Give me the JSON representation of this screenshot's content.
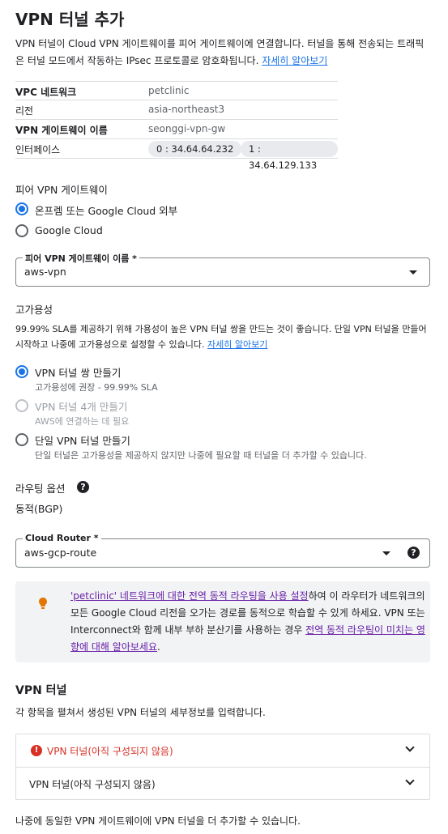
{
  "page": {
    "title": "VPN 터널 추가",
    "intro_text": "VPN 터널이 Cloud VPN 게이트웨이를 피어 게이트웨이에 연결합니다. 터널을 통해 전송되는 트래픽은 터널 모드에서 작동하는 IPsec 프로토콜로 암호화됩니다.",
    "intro_link": "자세히 알아보기"
  },
  "info_table": {
    "rows": [
      {
        "key": "VPC 네트워크",
        "value": "petclinic"
      },
      {
        "key": "리전",
        "value": "asia-northeast3"
      },
      {
        "key": "VPN 게이트웨이 이름",
        "value": "seonggi-vpn-gw"
      },
      {
        "key": "인터페이스",
        "value": ""
      }
    ],
    "interfaces": [
      "0 : 34.64.64.232",
      "1 : 34.64.129.133"
    ]
  },
  "peer_gateway": {
    "label": "피어 VPN 게이트웨이",
    "options": [
      {
        "label": "온프렘 또는 Google Cloud 외부",
        "selected": true
      },
      {
        "label": "Google Cloud",
        "selected": false
      }
    ],
    "name_field_label": "피어 VPN 게이트웨이 이름 *",
    "name_field_value": "aws-vpn"
  },
  "high_availability": {
    "label": "고가용성",
    "description": "99.99% SLA를 제공하기 위해 가용성이 높은 VPN 터널 쌍을 만드는 것이 좋습니다. 단일 VPN 터널을 만들어 시작하고 나중에 고가용성으로 설정할 수 있습니다.",
    "link": "자세히 알아보기",
    "options": [
      {
        "label": "VPN 터널 쌍 만들기",
        "sub": "고가용성에 권장 - 99.99% SLA",
        "selected": true,
        "disabled": false
      },
      {
        "label": "VPN 터널 4개 만들기",
        "sub": "AWS에 연결하는 데 필요",
        "selected": false,
        "disabled": true
      },
      {
        "label": "단일 VPN 터널 만들기",
        "sub": "단일 터널은 고가용성을 제공하지 않지만 나중에 필요할 때 터널을 더 추가할 수 있습니다.",
        "selected": false,
        "disabled": false
      }
    ]
  },
  "routing": {
    "label": "라우팅 옵션",
    "value": "동적(BGP)",
    "router_field_label": "Cloud Router *",
    "router_field_value": "aws-gcp-route"
  },
  "callout": {
    "link1": "'petclinic' 네트워크에 대한 전역 동적 라우팅을 사용 설정",
    "text1": "하여 이 라우터가 네트워크의 모든 Google Cloud 리전을 오가는 경로를 동적으로 학습할 수 있게 하세요. VPN 또는 Interconnect와 함께 내부 부하 분산기를 사용하는 경우 ",
    "link2": "전역 동적 라우팅이 미치는 영향에 대해 알아보세요",
    "text2": "."
  },
  "tunnels": {
    "label": "VPN 터널",
    "description": "각 항목을 펼쳐서 생성된 VPN 터널의 세부정보를 입력합니다.",
    "items": [
      {
        "label": "VPN 터널(아직 구성되지 않음)",
        "error": true
      },
      {
        "label": "VPN 터널(아직 구성되지 않음)",
        "error": false
      }
    ],
    "footer": "나중에 동일한 VPN 게이트웨이에 VPN 터널을 더 추가할 수 있습니다."
  },
  "colors": {
    "accent": "#1a73e8",
    "error": "#d93025",
    "warning": "#e37400",
    "link_visited": "#681da8"
  }
}
